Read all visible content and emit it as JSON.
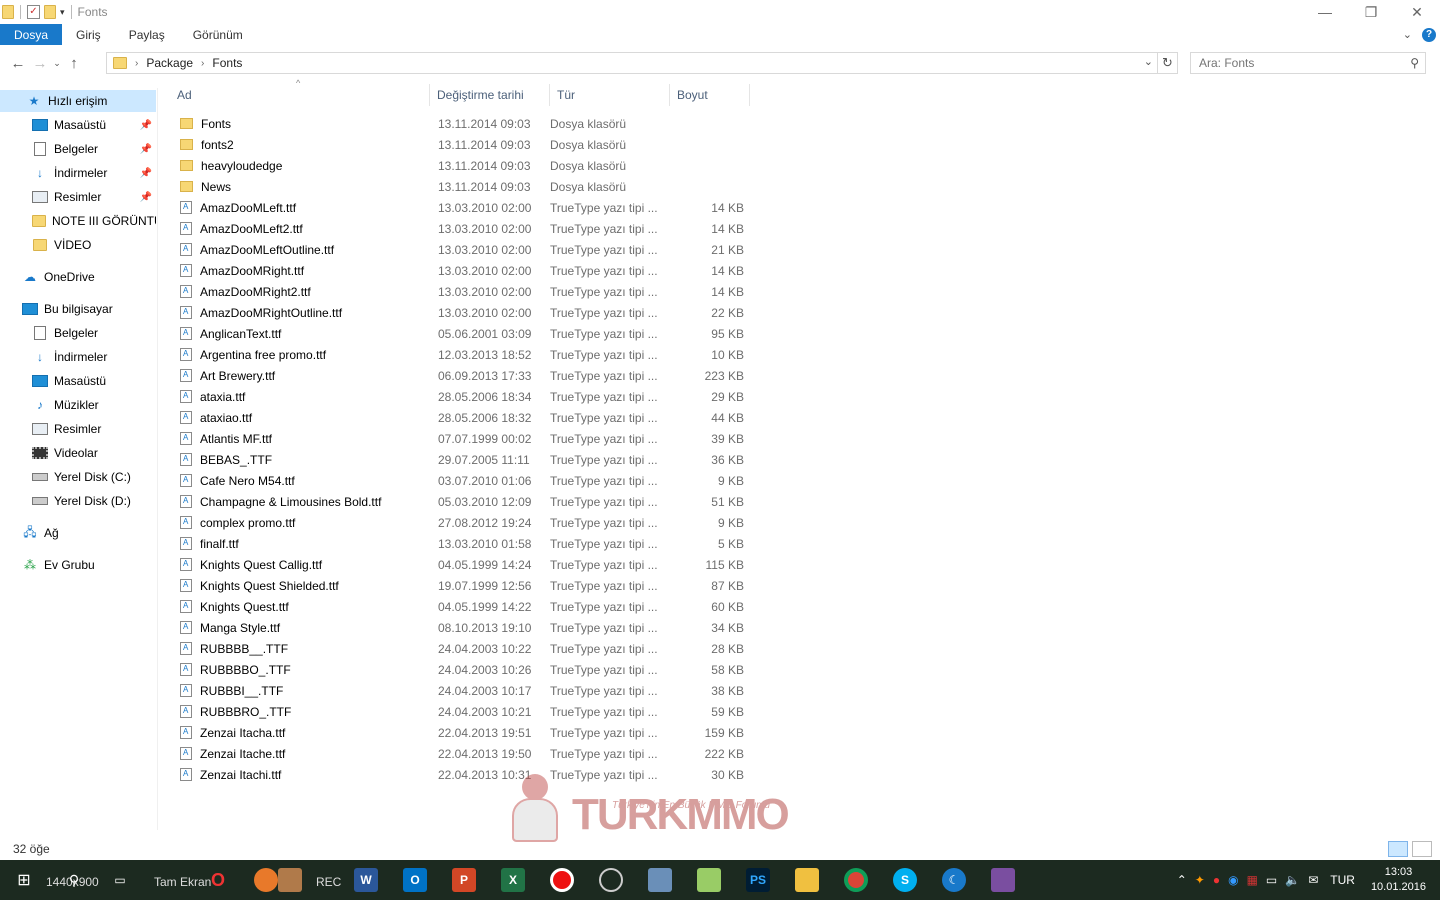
{
  "window": {
    "title": "Fonts"
  },
  "ribbon": {
    "tabs": [
      "Dosya",
      "Giriş",
      "Paylaş",
      "Görünüm"
    ]
  },
  "address": {
    "crumbs": [
      "Package",
      "Fonts"
    ],
    "search_placeholder": "Ara: Fonts"
  },
  "navpane": {
    "quick_access": "Hızlı erişim",
    "quick_items": [
      "Masaüstü",
      "Belgeler",
      "İndirmeler",
      "Resimler",
      "NOTE III GÖRÜNTÜ",
      "VİDEO"
    ],
    "onedrive": "OneDrive",
    "this_pc": "Bu bilgisayar",
    "pc_items": [
      "Belgeler",
      "İndirmeler",
      "Masaüstü",
      "Müzikler",
      "Resimler",
      "Videolar",
      "Yerel Disk (C:)",
      "Yerel Disk (D:)"
    ],
    "network": "Ağ",
    "homegroup": "Ev Grubu"
  },
  "columns": {
    "name": "Ad",
    "date": "Değiştirme tarihi",
    "type": "Tür",
    "size": "Boyut"
  },
  "files": [
    {
      "name": "Fonts",
      "date": "13.11.2014 09:03",
      "type": "Dosya klasörü",
      "size": "",
      "kind": "folder"
    },
    {
      "name": "fonts2",
      "date": "13.11.2014 09:03",
      "type": "Dosya klasörü",
      "size": "",
      "kind": "folder"
    },
    {
      "name": "heavyloudedge",
      "date": "13.11.2014 09:03",
      "type": "Dosya klasörü",
      "size": "",
      "kind": "folder"
    },
    {
      "name": "News",
      "date": "13.11.2014 09:03",
      "type": "Dosya klasörü",
      "size": "",
      "kind": "folder"
    },
    {
      "name": "AmazDooMLeft.ttf",
      "date": "13.03.2010 02:00",
      "type": "TrueType yazı tipi ...",
      "size": "14 KB",
      "kind": "font"
    },
    {
      "name": "AmazDooMLeft2.ttf",
      "date": "13.03.2010 02:00",
      "type": "TrueType yazı tipi ...",
      "size": "14 KB",
      "kind": "font"
    },
    {
      "name": "AmazDooMLeftOutline.ttf",
      "date": "13.03.2010 02:00",
      "type": "TrueType yazı tipi ...",
      "size": "21 KB",
      "kind": "font"
    },
    {
      "name": "AmazDooMRight.ttf",
      "date": "13.03.2010 02:00",
      "type": "TrueType yazı tipi ...",
      "size": "14 KB",
      "kind": "font"
    },
    {
      "name": "AmazDooMRight2.ttf",
      "date": "13.03.2010 02:00",
      "type": "TrueType yazı tipi ...",
      "size": "14 KB",
      "kind": "font"
    },
    {
      "name": "AmazDooMRightOutline.ttf",
      "date": "13.03.2010 02:00",
      "type": "TrueType yazı tipi ...",
      "size": "22 KB",
      "kind": "font"
    },
    {
      "name": "AnglicanText.ttf",
      "date": "05.06.2001 03:09",
      "type": "TrueType yazı tipi ...",
      "size": "95 KB",
      "kind": "font"
    },
    {
      "name": "Argentina free promo.ttf",
      "date": "12.03.2013 18:52",
      "type": "TrueType yazı tipi ...",
      "size": "10 KB",
      "kind": "font"
    },
    {
      "name": "Art Brewery.ttf",
      "date": "06.09.2013 17:33",
      "type": "TrueType yazı tipi ...",
      "size": "223 KB",
      "kind": "font"
    },
    {
      "name": "ataxia.ttf",
      "date": "28.05.2006 18:34",
      "type": "TrueType yazı tipi ...",
      "size": "29 KB",
      "kind": "font"
    },
    {
      "name": "ataxiao.ttf",
      "date": "28.05.2006 18:32",
      "type": "TrueType yazı tipi ...",
      "size": "44 KB",
      "kind": "font"
    },
    {
      "name": "Atlantis MF.ttf",
      "date": "07.07.1999 00:02",
      "type": "TrueType yazı tipi ...",
      "size": "39 KB",
      "kind": "font"
    },
    {
      "name": "BEBAS_.TTF",
      "date": "29.07.2005 11:11",
      "type": "TrueType yazı tipi ...",
      "size": "36 KB",
      "kind": "font"
    },
    {
      "name": "Cafe Nero M54.ttf",
      "date": "03.07.2010 01:06",
      "type": "TrueType yazı tipi ...",
      "size": "9 KB",
      "kind": "font"
    },
    {
      "name": "Champagne & Limousines Bold.ttf",
      "date": "05.03.2010 12:09",
      "type": "TrueType yazı tipi ...",
      "size": "51 KB",
      "kind": "font"
    },
    {
      "name": "complex promo.ttf",
      "date": "27.08.2012 19:24",
      "type": "TrueType yazı tipi ...",
      "size": "9 KB",
      "kind": "font"
    },
    {
      "name": "finalf.ttf",
      "date": "13.03.2010 01:58",
      "type": "TrueType yazı tipi ...",
      "size": "5 KB",
      "kind": "font"
    },
    {
      "name": "Knights Quest Callig.ttf",
      "date": "04.05.1999 14:24",
      "type": "TrueType yazı tipi ...",
      "size": "115 KB",
      "kind": "font"
    },
    {
      "name": "Knights Quest Shielded.ttf",
      "date": "19.07.1999 12:56",
      "type": "TrueType yazı tipi ...",
      "size": "87 KB",
      "kind": "font"
    },
    {
      "name": "Knights Quest.ttf",
      "date": "04.05.1999 14:22",
      "type": "TrueType yazı tipi ...",
      "size": "60 KB",
      "kind": "font"
    },
    {
      "name": "Manga Style.ttf",
      "date": "08.10.2013 19:10",
      "type": "TrueType yazı tipi ...",
      "size": "34 KB",
      "kind": "font"
    },
    {
      "name": "RUBBBB__.TTF",
      "date": "24.04.2003 10:22",
      "type": "TrueType yazı tipi ...",
      "size": "28 KB",
      "kind": "font"
    },
    {
      "name": "RUBBBBO_.TTF",
      "date": "24.04.2003 10:26",
      "type": "TrueType yazı tipi ...",
      "size": "58 KB",
      "kind": "font"
    },
    {
      "name": "RUBBBI__.TTF",
      "date": "24.04.2003 10:17",
      "type": "TrueType yazı tipi ...",
      "size": "38 KB",
      "kind": "font"
    },
    {
      "name": "RUBBBRO_.TTF",
      "date": "24.04.2003 10:21",
      "type": "TrueType yazı tipi ...",
      "size": "59 KB",
      "kind": "font"
    },
    {
      "name": "Zenzai Itacha.ttf",
      "date": "22.04.2013 19:51",
      "type": "TrueType yazı tipi ...",
      "size": "159 KB",
      "kind": "font"
    },
    {
      "name": "Zenzai Itache.ttf",
      "date": "22.04.2013 19:50",
      "type": "TrueType yazı tipi ...",
      "size": "222 KB",
      "kind": "font"
    },
    {
      "name": "Zenzai Itachi.ttf",
      "date": "22.04.2013 10:31",
      "type": "TrueType yazı tipi ...",
      "size": "30 KB",
      "kind": "font"
    }
  ],
  "status": {
    "count": "32 öğe"
  },
  "watermark": {
    "logo": "TURKMMO",
    "tagline": "Türkiye'nin En Büyük MMO Forumu"
  },
  "taskbar": {
    "overlay_resolution": "1440x900",
    "overlay_fullscreen": "Tam Ekran",
    "overlay_rec": "REC",
    "apps": [
      "W",
      "O",
      "P",
      "X",
      "PS"
    ],
    "language": "TUR",
    "time": "13:03",
    "date": "10.01.2016"
  },
  "colors": {
    "accent": "#1979ca",
    "selection": "#cce8ff",
    "taskbar": "#1c2a20"
  }
}
